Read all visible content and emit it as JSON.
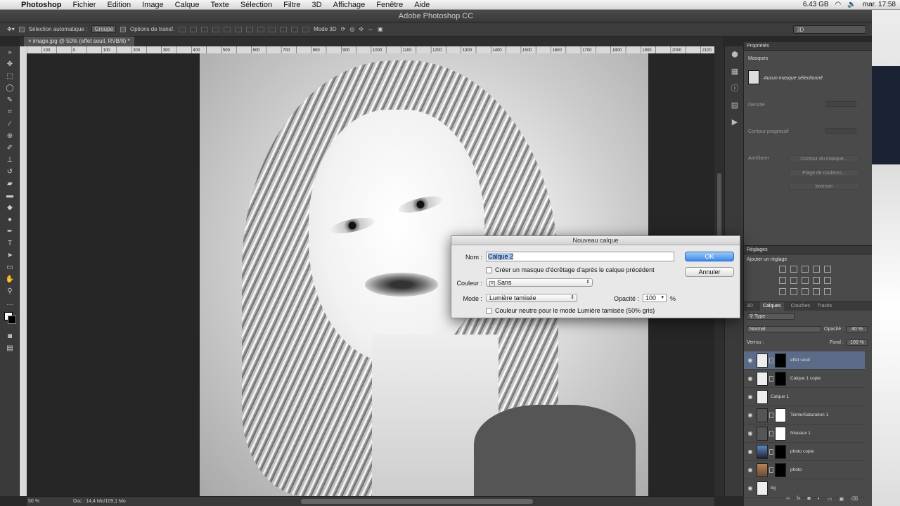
{
  "menubar": {
    "app": "Photoshop",
    "items": [
      "Fichier",
      "Edition",
      "Image",
      "Calque",
      "Texte",
      "Sélection",
      "Filtre",
      "3D",
      "Affichage",
      "Fenêtre",
      "Aide"
    ],
    "memory": "6.43 GB",
    "clock": "mar. 17:58"
  },
  "window": {
    "title": "Adobe Photoshop CC"
  },
  "options": {
    "auto_select_label": "Sélection automatique :",
    "auto_select_value": "Groupe",
    "transform_label": "Options de transf.",
    "mode3d_label": "Mode 3D",
    "workspace": "3D"
  },
  "document": {
    "tab": "image.jpg @ 50% (effet seuil, RVB/8) *"
  },
  "ruler": {
    "ticks": [
      "150",
      "100",
      "50",
      "0",
      "50",
      "100",
      "150",
      "200",
      "250",
      "300",
      "350",
      "400",
      "450",
      "500",
      "550",
      "600",
      "650",
      "700",
      "750",
      "800",
      "850",
      "900",
      "950",
      "1000",
      "1050",
      "1100",
      "1150",
      "1200",
      "1250",
      "1300",
      "1350",
      "1400",
      "1450",
      "1500",
      "1550",
      "1600",
      "1650",
      "1700",
      "1750",
      "1800",
      "1850",
      "1900",
      "1950",
      "2000",
      "2050",
      "2100"
    ]
  },
  "status": {
    "zoom": "50 %",
    "doc": "Doc : 14,4 Mo/109,1 Mo"
  },
  "properties": {
    "title": "Propriétés",
    "section": "Masques",
    "mask_text": "Aucun masque sélectionné",
    "density": "Densité",
    "feather": "Contour progressif",
    "refine": "Améliorer",
    "btn_edge": "Contour du masque...",
    "btn_color": "Plage de couleurs...",
    "btn_invert": "Inverser"
  },
  "adjust": {
    "title": "Réglages",
    "add": "Ajouter un réglage"
  },
  "layers": {
    "tabs": [
      "3D",
      "Calques",
      "Couches",
      "Tracés"
    ],
    "filter": "Type",
    "blend": "Normal",
    "opacity_label": "Opacité :",
    "opacity": "40 %",
    "lock_label": "Verrou :",
    "fill_label": "Fond :",
    "fill": "100 %",
    "items": [
      {
        "name": "effet seuil"
      },
      {
        "name": "Calque 1 copie"
      },
      {
        "name": "Calque 1"
      },
      {
        "name": "Teinte/Saturation 1"
      },
      {
        "name": "Niveaux 1"
      },
      {
        "name": "photo copie"
      },
      {
        "name": "photo"
      },
      {
        "name": "bg"
      }
    ]
  },
  "dialog": {
    "title": "Nouveau calque",
    "name_label": "Nom :",
    "name_value": "Calque 2",
    "clip_label": "Créer un masque d'écrêtage d'après le calque précédent",
    "color_label": "Couleur :",
    "color_value": "Sans",
    "mode_label": "Mode :",
    "mode_value": "Lumière tamisée",
    "opacity_label": "Opacité :",
    "opacity_value": "100",
    "percent": "%",
    "neutral_label": "Couleur neutre pour le mode Lumière tamisée (50% gris)",
    "ok": "OK",
    "cancel": "Annuler"
  }
}
